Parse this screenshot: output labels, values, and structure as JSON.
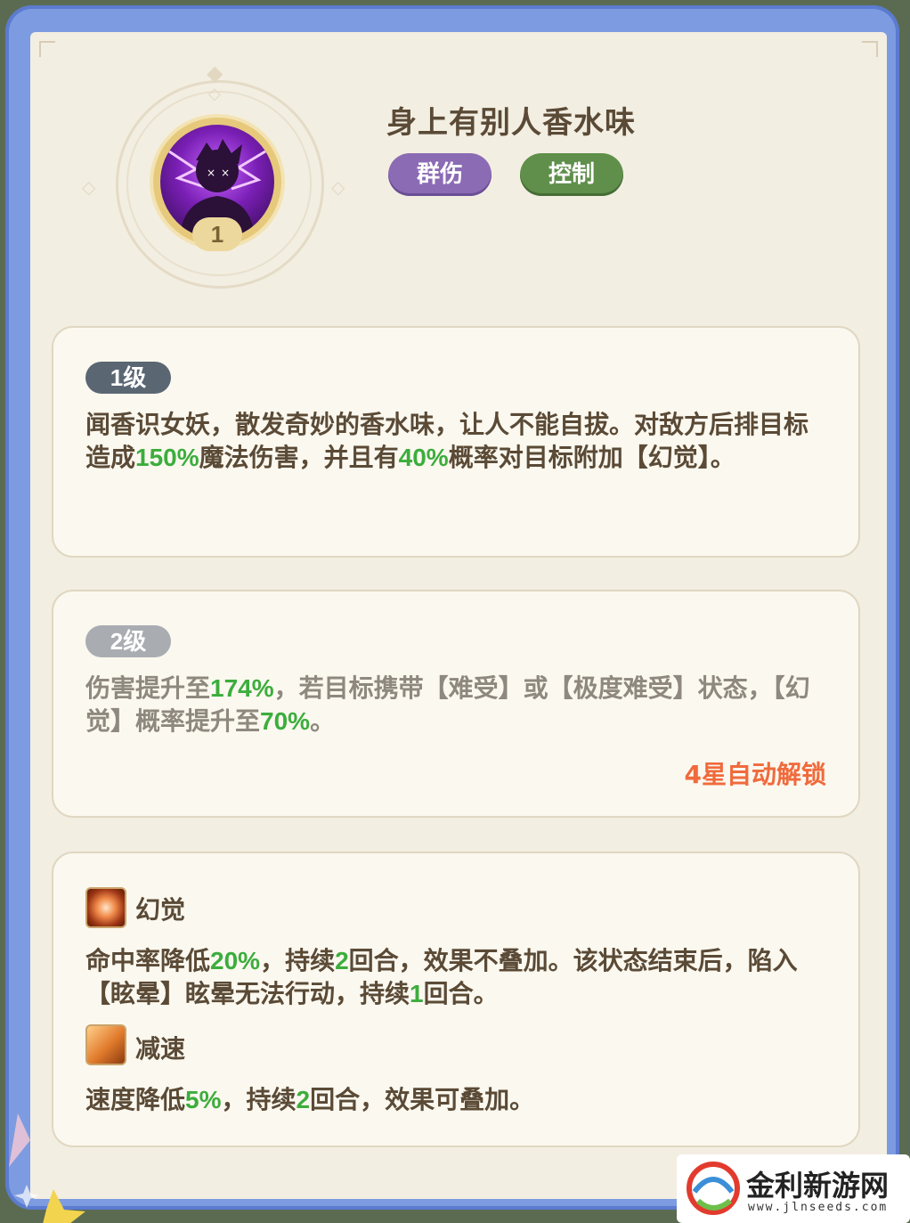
{
  "skill": {
    "name": "身上有别人香水味",
    "level_badge": "1",
    "tags": [
      "群伤",
      "控制"
    ]
  },
  "levels": [
    {
      "label": "1级",
      "desc_parts": [
        "闻香识女妖，散发奇妙的香水味，让人不能自拔。对敌方后排目标造成",
        "150%",
        "魔法伤害，并且有",
        "40%",
        "概率对目标附加【幻觉】。"
      ]
    },
    {
      "label": "2级",
      "desc_parts": [
        "伤害提升至",
        "174%",
        "，若目标携带【难受】或【极度难受】状态，【幻觉】概率提升至",
        "70%",
        "。"
      ],
      "unlock_text": "4星自动解锁"
    }
  ],
  "statuses": [
    {
      "icon": "illusion-icon",
      "name": "幻觉",
      "desc_parts": [
        "命中率降低",
        "20%",
        "，持续",
        "2",
        "回合，效果不叠加。该状态结束后，陷入【眩晕】眩晕无法行动，持续",
        "1",
        "回合。"
      ]
    },
    {
      "icon": "slow-icon",
      "name": "减速",
      "desc_parts": [
        "速度降低",
        "5%",
        "，持续",
        "2",
        "回合，效果可叠加。"
      ]
    }
  ],
  "watermark": {
    "name": "金利新游网",
    "url": "www.jlnseeds.com"
  },
  "colors": {
    "highlight": "#3cad3c",
    "unlock": "#f06a3c",
    "tag_purple": "#8b6bb4",
    "tag_green": "#5f8f4a"
  }
}
